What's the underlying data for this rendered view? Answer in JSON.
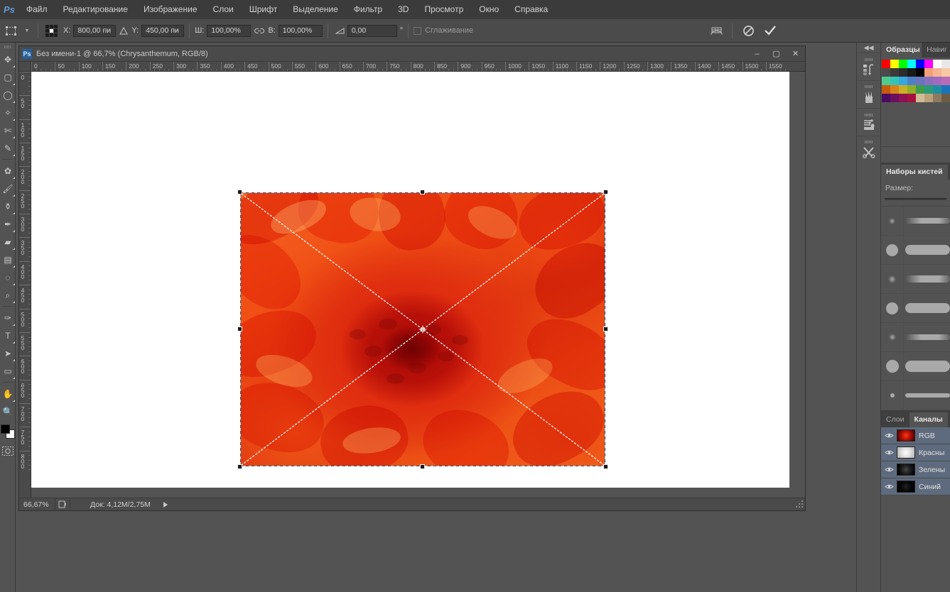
{
  "app": {
    "logo": "Ps"
  },
  "menubar": {
    "items": [
      {
        "label": "Файл"
      },
      {
        "label": "Редактирование"
      },
      {
        "label": "Изображение"
      },
      {
        "label": "Слои"
      },
      {
        "label": "Шрифт"
      },
      {
        "label": "Выделение"
      },
      {
        "label": "Фильтр"
      },
      {
        "label": "3D"
      },
      {
        "label": "Просмотр"
      },
      {
        "label": "Окно"
      },
      {
        "label": "Справка"
      }
    ]
  },
  "options_bar": {
    "tool_icon": "free-transform-icon",
    "preset_arrow": "chevron-down-icon",
    "reference_point_label": "reference-point-grid",
    "x_label": "X:",
    "x_value": "800,00 пи",
    "delta_icon_1": "delta-icon",
    "y_label": "Y:",
    "y_value": "450,00 пи",
    "w_label": "Ш:",
    "w_value": "100,00%",
    "link_icon": "link-icon",
    "h_label": "В:",
    "h_value": "100,00%",
    "angle_icon": "shear-icon",
    "angle_value": "0,00",
    "degree_symbol": "°",
    "antialias_label": "Сглаживание",
    "warp_icon": "warp-mode-icon",
    "cancel_icon": "cancel-transform-icon",
    "commit_icon": "commit-transform-icon"
  },
  "toolbar": {
    "tools": [
      {
        "name": "move-tool",
        "glyph": "✥",
        "has_submenu": true,
        "selected": false
      },
      {
        "name": "rectangular-marquee-tool",
        "glyph": "▢",
        "has_submenu": true,
        "selected": false
      },
      {
        "name": "lasso-tool",
        "glyph": "◯",
        "has_submenu": true,
        "selected": false
      },
      {
        "name": "quick-selection-tool",
        "glyph": "✧",
        "has_submenu": true,
        "selected": false
      },
      {
        "name": "crop-tool",
        "glyph": "✄",
        "has_submenu": true,
        "selected": false
      },
      {
        "name": "eyedropper-tool",
        "glyph": "✎",
        "has_submenu": true,
        "selected": false
      },
      {
        "name": "spot-healing-brush-tool",
        "glyph": "✿",
        "has_submenu": true,
        "selected": false
      },
      {
        "name": "brush-tool",
        "glyph": "🖌",
        "has_submenu": true,
        "selected": false
      },
      {
        "name": "clone-stamp-tool",
        "glyph": "⚱",
        "has_submenu": true,
        "selected": false
      },
      {
        "name": "history-brush-tool",
        "glyph": "✒",
        "has_submenu": true,
        "selected": false
      },
      {
        "name": "eraser-tool",
        "glyph": "▰",
        "has_submenu": true,
        "selected": false
      },
      {
        "name": "gradient-tool",
        "glyph": "▤",
        "has_submenu": true,
        "selected": false
      },
      {
        "name": "blur-tool",
        "glyph": "◌",
        "has_submenu": true,
        "selected": false
      },
      {
        "name": "dodge-tool",
        "glyph": "⌕",
        "has_submenu": true,
        "selected": false
      },
      {
        "name": "pen-tool",
        "glyph": "✑",
        "has_submenu": true,
        "selected": false
      },
      {
        "name": "horizontal-type-tool",
        "glyph": "T",
        "has_submenu": true,
        "selected": false
      },
      {
        "name": "path-selection-tool",
        "glyph": "➤",
        "has_submenu": true,
        "selected": false
      },
      {
        "name": "rectangle-tool",
        "glyph": "▭",
        "has_submenu": true,
        "selected": false
      },
      {
        "name": "hand-tool",
        "glyph": "✋",
        "has_submenu": true,
        "selected": false
      },
      {
        "name": "zoom-tool",
        "glyph": "🔍",
        "has_submenu": false,
        "selected": false
      }
    ],
    "swap_colors_icon": "swap-colors-icon",
    "foreground_color": "#000000",
    "background_color": "#ffffff",
    "quick_mask_icon": "quick-mask-icon"
  },
  "document": {
    "title": "Без имени-1 @ 66,7% (Chrysanthemum, RGB/8)",
    "icon": "Ps",
    "window_buttons": {
      "minimize": "–",
      "maximize": "▢",
      "close": "✕"
    },
    "rulers": {
      "horizontal_ticks": [
        0,
        50,
        100,
        150,
        200,
        250,
        300,
        350,
        400,
        450,
        500,
        550,
        600,
        650,
        700,
        750,
        800,
        850,
        900,
        950,
        1000,
        1050,
        1100,
        1150,
        1200,
        1250,
        1300,
        1350,
        1400,
        1450,
        1500,
        1550
      ],
      "vertical_ticks": [
        0,
        50,
        100,
        150,
        200,
        250,
        300,
        350,
        400,
        450,
        500,
        550,
        600,
        650,
        700,
        750,
        800
      ],
      "unit": "пи"
    },
    "image_name": "Chrysanthemum",
    "status": {
      "zoom": "66,67%",
      "doc_icon": "doc-profile-icon",
      "doc_size": "Док: 4,12M/2,75M",
      "expand_arrow": "▶"
    },
    "transform": {
      "handles": 8,
      "center_reference_point": true,
      "diagonals_visible": true
    }
  },
  "icon_dock": {
    "collapse_icon": "collapse-panels-icon",
    "icons": [
      {
        "name": "history-icon"
      },
      {
        "name": "brush-panel-icon"
      },
      {
        "name": "adjustments-icon"
      },
      {
        "name": "tool-presets-icon"
      }
    ]
  },
  "right_panel": {
    "swatches_group": {
      "tabs": [
        {
          "label": "Образцы",
          "active": true
        },
        {
          "label": "Навиг",
          "active": false
        }
      ],
      "swatch_colors": [
        [
          "#ff0000",
          "#ffff00",
          "#00ff00",
          "#00ffff",
          "#0000ff",
          "#ff00ff",
          "#ffffff",
          "#e8e8e8"
        ],
        [
          "#4a4a4a",
          "#3a3a3a",
          "#2c2c2c",
          "#1a1a1a",
          "#000000",
          "#f2a07a",
          "#f5b594",
          "#f7c9a5"
        ],
        [
          "#4ecb8e",
          "#35c2b8",
          "#36a8dd",
          "#4f7fc4",
          "#6a74bd",
          "#8a6fc0",
          "#a369c0",
          "#b96bb8"
        ],
        [
          "#c85a10",
          "#d98218",
          "#c9b024",
          "#8fae2a",
          "#3f9a4a",
          "#2a9a78",
          "#1f8fa0",
          "#1a74b8"
        ],
        [
          "#4b0b63",
          "#6b0f5e",
          "#8c1054",
          "#a5103f",
          "#d2bb96",
          "#bba07c",
          "#8e7a5f",
          "#6e5b44"
        ]
      ]
    },
    "brush_group": {
      "tabs": [
        {
          "label": "Наборы кистей",
          "active": true
        }
      ],
      "size_label": "Размер:",
      "presets": [
        {
          "size": 9,
          "soft": true
        },
        {
          "size": 17,
          "soft": false
        },
        {
          "size": 11,
          "soft": true
        },
        {
          "size": 17,
          "soft": false
        },
        {
          "size": 10,
          "soft": true
        },
        {
          "size": 18,
          "soft": false
        },
        {
          "size": 6,
          "soft": false
        }
      ]
    },
    "channels_group": {
      "tabs": [
        {
          "label": "Слои",
          "active": false
        },
        {
          "label": "Каналы",
          "active": true
        }
      ],
      "channels": [
        {
          "name": "RGB",
          "visible": true,
          "selected": true,
          "thumb": "rgb"
        },
        {
          "name": "Красны",
          "visible": true,
          "selected": true,
          "thumb": "red"
        },
        {
          "name": "Зелены",
          "visible": true,
          "selected": true,
          "thumb": "green"
        },
        {
          "name": "Синий",
          "visible": true,
          "selected": true,
          "thumb": "blue"
        }
      ],
      "eye_icon": "eye-icon"
    }
  }
}
